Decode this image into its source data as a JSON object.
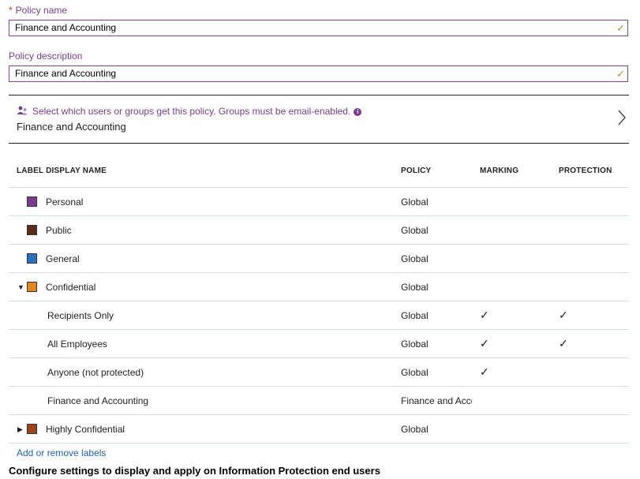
{
  "form": {
    "required_marker": "*",
    "policy_name_label": "Policy name",
    "policy_name_value": "Finance and Accounting",
    "policy_description_label": "Policy description",
    "policy_description_value": "Finance and Accounting"
  },
  "groups": {
    "hint": "Select which users or groups get this policy. Groups must be email-enabled.",
    "value": "Finance and Accounting"
  },
  "table": {
    "headers": {
      "label": "LABEL DISPLAY NAME",
      "policy": "POLICY",
      "marking": "MARKING",
      "protection": "PROTECTION"
    },
    "rows": [
      {
        "name": "Personal",
        "policy": "Global",
        "color": "#7b3b8e",
        "marking": false,
        "protection": false
      },
      {
        "name": "Public",
        "policy": "Global",
        "color": "#5a2a1a",
        "marking": false,
        "protection": false
      },
      {
        "name": "General",
        "policy": "Global",
        "color": "#2b6fc4",
        "marking": false,
        "protection": false
      },
      {
        "name": "Confidential",
        "policy": "Global",
        "color": "#e08a1e",
        "expanded": true,
        "marking": false,
        "protection": false
      },
      {
        "name": "Recipients Only",
        "policy": "Global",
        "marking": true,
        "protection": true
      },
      {
        "name": "All Employees",
        "policy": "Global",
        "marking": true,
        "protection": true
      },
      {
        "name": "Anyone (not protected)",
        "policy": "Global",
        "marking": true,
        "protection": false
      },
      {
        "name": "Finance and Accounting",
        "policy": "Finance and Accounting",
        "marking": false,
        "protection": false
      },
      {
        "name": "Highly Confidential",
        "policy": "Global",
        "color": "#a0421a",
        "expanded": false,
        "marking": false,
        "protection": false
      }
    ]
  },
  "add_remove_link": "Add or remove labels",
  "section_title": "Configure settings to display and apply on Information Protection end users",
  "colors": {
    "accent": "#7a3b91",
    "valid_check": "#c08a1e",
    "link": "#1a62b4",
    "required": "#d83b01"
  }
}
